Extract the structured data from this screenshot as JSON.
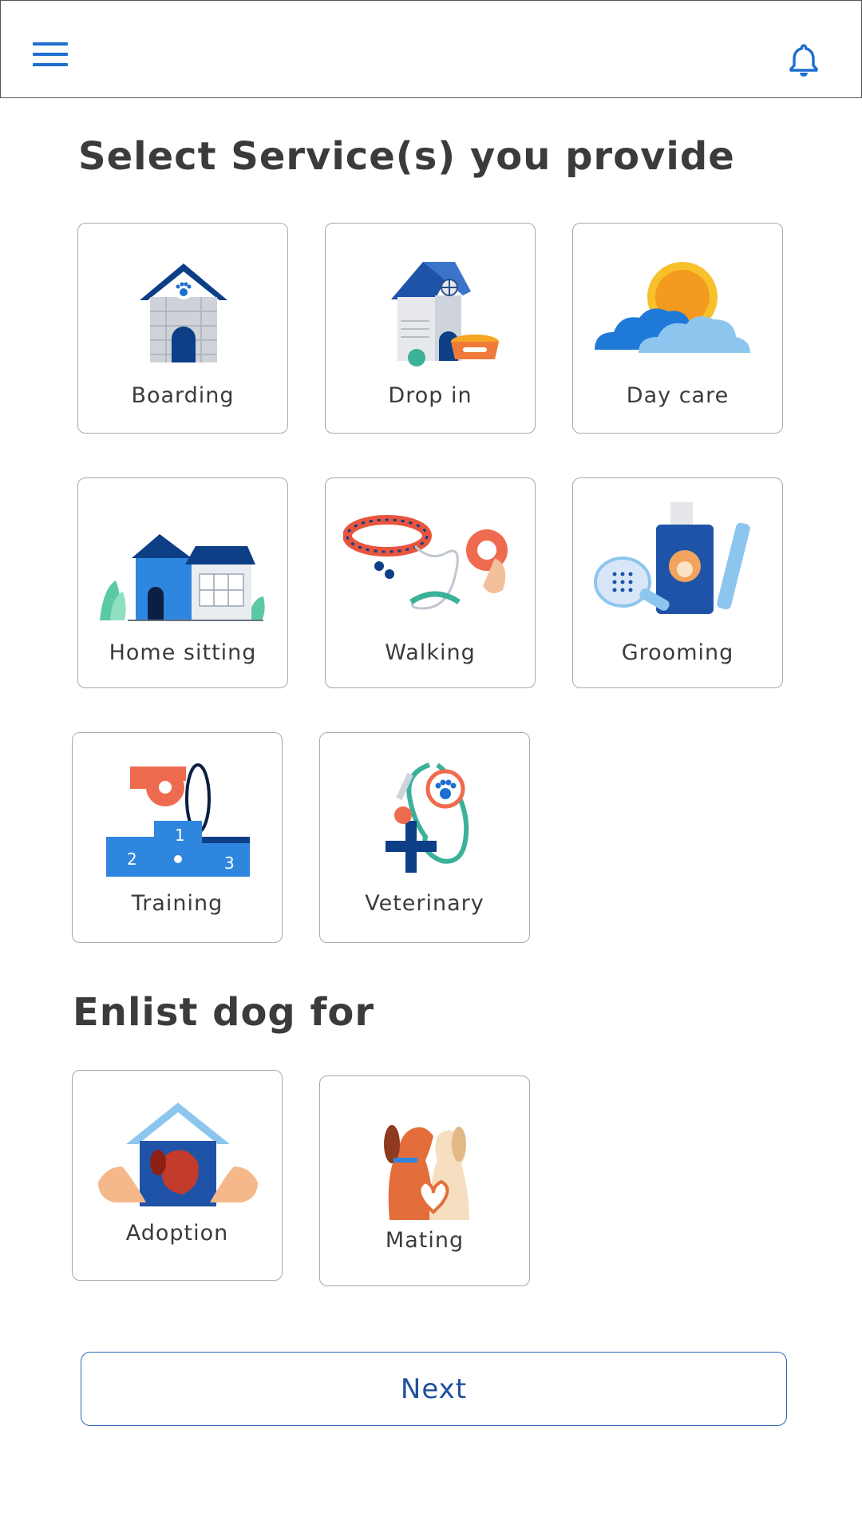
{
  "header": {
    "menu_icon": "hamburger-menu-icon",
    "notification_icon": "bell-icon",
    "accent": "#1e6fd0"
  },
  "services": {
    "title": "Select Service(s) you provide",
    "items": [
      {
        "label": "Boarding",
        "icon": "dog-house-paw-icon"
      },
      {
        "label": "Drop in",
        "icon": "dog-house-food-bowl-icon"
      },
      {
        "label": "Day care",
        "icon": "sun-clouds-icon"
      },
      {
        "label": "Home sitting",
        "icon": "house-plants-icon"
      },
      {
        "label": "Walking",
        "icon": "collar-leash-icon"
      },
      {
        "label": "Grooming",
        "icon": "shampoo-brush-comb-icon"
      },
      {
        "label": "Training",
        "icon": "whistle-podium-icon"
      },
      {
        "label": "Veterinary",
        "icon": "stethoscope-syringe-icon"
      }
    ]
  },
  "enlist": {
    "title": "Enlist dog  for",
    "items": [
      {
        "label": "Adoption",
        "icon": "dog-house-hands-icon"
      },
      {
        "label": "Mating",
        "icon": "two-dogs-heart-icon"
      }
    ]
  },
  "actions": {
    "next_label": "Next"
  }
}
